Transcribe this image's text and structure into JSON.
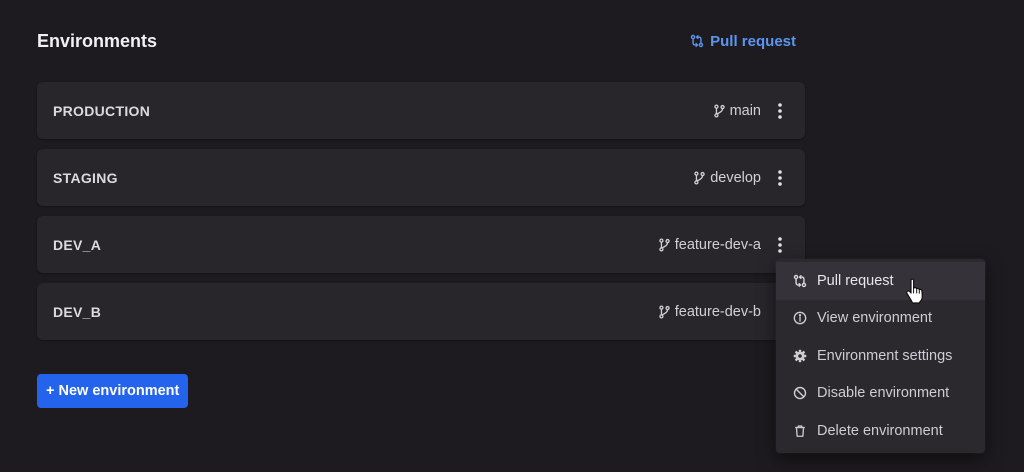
{
  "header": {
    "title": "Environments",
    "pull_request_label": "Pull request"
  },
  "environments": [
    {
      "name": "PRODUCTION",
      "branch": "main"
    },
    {
      "name": "STAGING",
      "branch": "develop"
    },
    {
      "name": "DEV_A",
      "branch": "feature-dev-a"
    },
    {
      "name": "DEV_B",
      "branch": "feature-dev-b"
    }
  ],
  "new_environment_label": "+ New environment",
  "context_menu": {
    "open_for": "DEV_A",
    "hovered_item": "Pull request",
    "items": [
      {
        "label": "Pull request",
        "icon": "pull-request-icon"
      },
      {
        "label": "View environment",
        "icon": "info-icon"
      },
      {
        "label": "Environment settings",
        "icon": "gear-icon"
      },
      {
        "label": "Disable environment",
        "icon": "ban-icon"
      },
      {
        "label": "Delete environment",
        "icon": "trash-icon"
      }
    ]
  },
  "colors": {
    "background": "#1d1b1f",
    "card": "#28262b",
    "accent_link": "#5b95f0",
    "primary_button": "#2463eb",
    "menu_bg": "#2b292e"
  }
}
